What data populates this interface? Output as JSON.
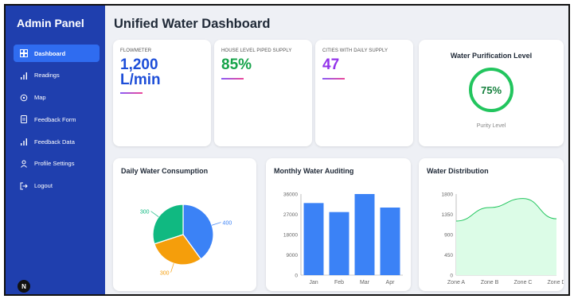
{
  "sidebar": {
    "title": "Admin Panel",
    "items": [
      {
        "label": "Dashboard",
        "icon": "dashboard-icon",
        "active": true
      },
      {
        "label": "Readings",
        "icon": "bar-chart-icon"
      },
      {
        "label": "Map",
        "icon": "map-pin-icon"
      },
      {
        "label": "Feedback Form",
        "icon": "form-icon"
      },
      {
        "label": "Feedback Data",
        "icon": "bar-chart-icon"
      },
      {
        "label": "Profile Settings",
        "icon": "user-icon"
      },
      {
        "label": "Logout",
        "icon": "logout-icon"
      }
    ],
    "avatar": "N"
  },
  "header": {
    "title": "Unified Water Dashboard"
  },
  "stats": [
    {
      "label": "FLOWMETER",
      "value": "1,200",
      "value2": "L/min",
      "color": "#1d4ed8"
    },
    {
      "label": "HOUSE LEVEL PIPED SUPPLY",
      "value": "85%",
      "color": "#16a34a"
    },
    {
      "label": "CITIES WITH DAILY SUPPLY",
      "value": "47",
      "color": "#9333ea"
    }
  ],
  "purity": {
    "title": "Water Purification Level",
    "value": "75%",
    "caption": "Purity Level",
    "color": "#22c55e"
  },
  "chart_data": [
    {
      "type": "pie",
      "title": "Daily Water Consumption",
      "values": [
        400,
        300,
        300
      ],
      "labels": [
        "400",
        "300",
        "300"
      ],
      "colors": [
        "#3b82f6",
        "#f59e0b",
        "#10b981"
      ]
    },
    {
      "type": "bar",
      "title": "Monthly Water Auditing",
      "categories": [
        "Jan",
        "Feb",
        "Mar",
        "Apr"
      ],
      "values": [
        32000,
        28000,
        36000,
        30000
      ],
      "yticks": [
        "0",
        "9000",
        "18000",
        "27000",
        "36000"
      ],
      "ylim": [
        0,
        36000
      ],
      "color": "#3b82f6"
    },
    {
      "type": "area",
      "title": "Water Distribution",
      "categories": [
        "Zone A",
        "Zone B",
        "Zone C",
        "Zone D"
      ],
      "values": [
        1200,
        1500,
        1700,
        1250
      ],
      "yticks": [
        "0",
        "450",
        "900",
        "1350",
        "1800"
      ],
      "ylim": [
        0,
        1800
      ],
      "color": "#22c55e"
    }
  ]
}
